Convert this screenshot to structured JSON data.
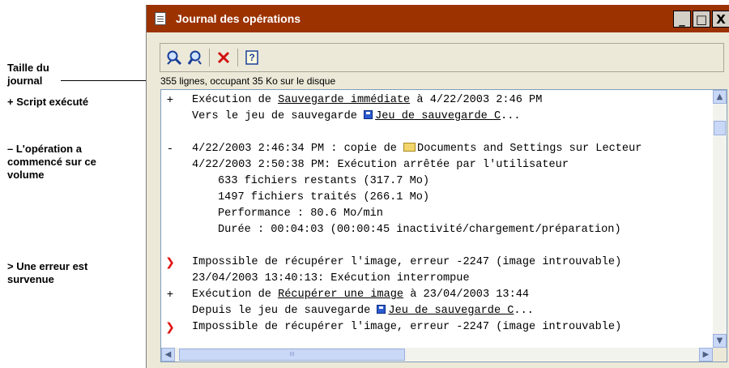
{
  "callouts": {
    "journal_size_line1": "Taille du",
    "journal_size_line2": "journal",
    "script_executed": "+ Script exécuté",
    "operation_started_line1": "– L'opération a",
    "operation_started_line2": "commencé sur ce",
    "operation_started_line3": "volume",
    "error_line1": "> Une erreur est",
    "error_line2": "survenue"
  },
  "window": {
    "title": "Journal des opérations",
    "minimize_symbol": "_",
    "maximize_symbol": "□",
    "close_symbol": "X"
  },
  "toolbar": {
    "icons": [
      "find-icon",
      "find-next-icon",
      "delete-icon",
      "help-icon"
    ],
    "help_symbol": "?"
  },
  "status": "355 lignes, occupant 35 Ko sur le disque",
  "log": {
    "markers": {
      "plus": "+",
      "minus": "-",
      "error": "❯"
    },
    "l1_prefix": "Exécution de ",
    "l1_link": "Sauvegarde immédiate",
    "l1_suffix": " à 4/22/2003 2:46 PM",
    "l2_prefix": "Vers le jeu de sauvegarde ",
    "l2_link": "Jeu de sauvegarde C",
    "l2_suffix": "...",
    "l3_prefix": "4/22/2003 2:46:34 PM : copie de ",
    "l3_suffix": "Documents and Settings sur Lecteur",
    "l4": "4/22/2003 2:50:38 PM: Exécution arrêtée par l'utilisateur",
    "l5": "633 fichiers restants (317.7 Mo)",
    "l6": "1497 fichiers traités (266.1 Mo)",
    "l7": "Performance : 80.6 Mo/min",
    "l8": "Durée : 00:04:03 (00:00:45 inactivité/chargement/préparation)",
    "l9": "Impossible de récupérer l'image, erreur -2247 (image introuvable)",
    "l10": "23/04/2003 13:40:13: Exécution interrompue",
    "l11_prefix": "Exécution de ",
    "l11_link": "Récupérer une image",
    "l11_suffix": " à 23/04/2003 13:44",
    "l12_prefix": "Depuis le jeu de sauvegarde ",
    "l12_link": "Jeu de sauvegarde C",
    "l12_suffix": "...",
    "l13": "Impossible de récupérer l'image, erreur -2247 (image introuvable)"
  },
  "scrollbars": {
    "up": "▲",
    "down": "▼",
    "left": "◀",
    "right": "▶",
    "grip": "III"
  },
  "colors": {
    "titlebar": "#9c3200",
    "error_marker": "#e01010",
    "window_face": "#ece9d8",
    "scroll_accent": "#c9d8f7"
  }
}
